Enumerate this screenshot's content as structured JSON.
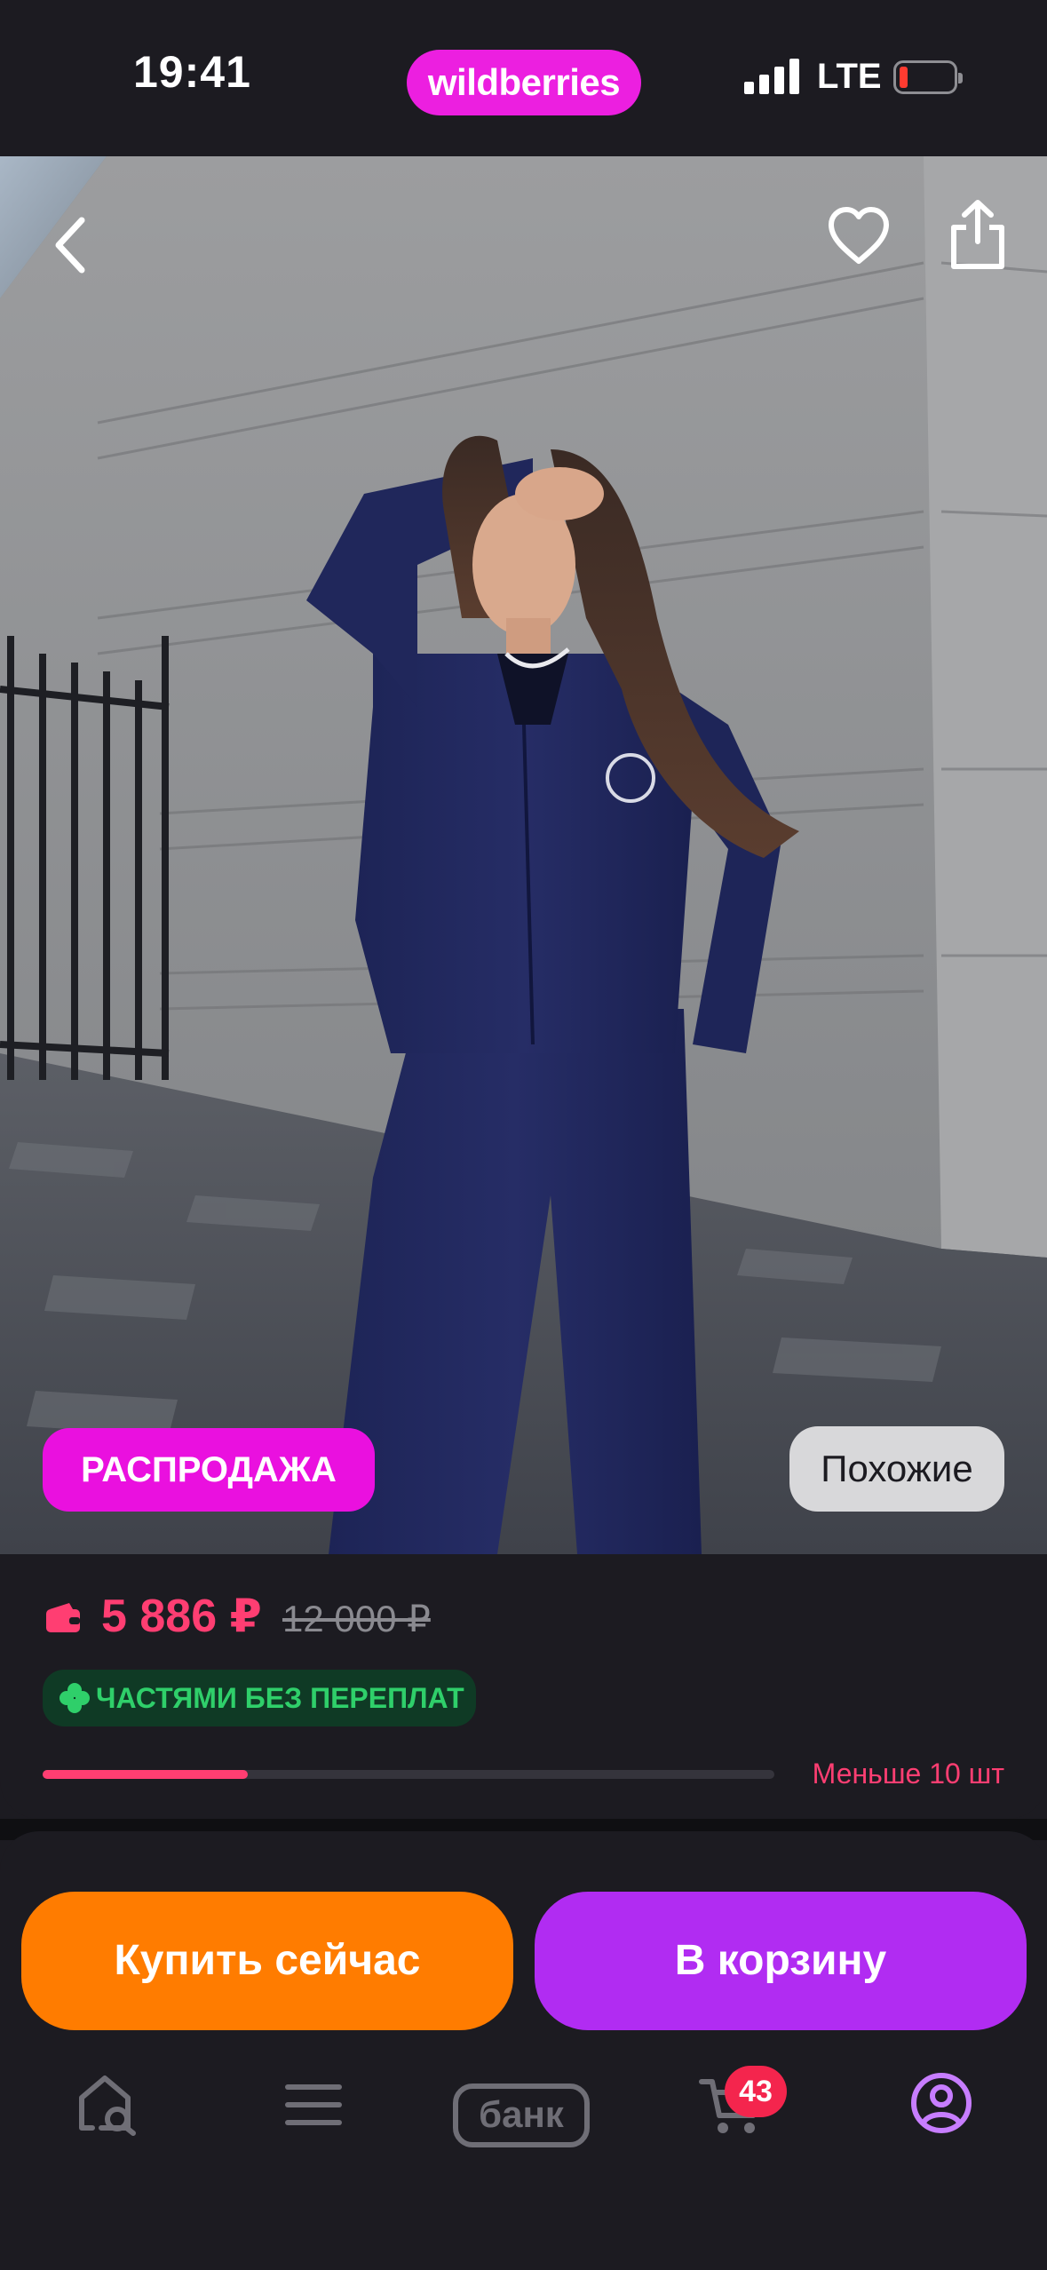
{
  "status_bar": {
    "time": "19:41",
    "network": "LTE",
    "brand": "wildberries"
  },
  "product": {
    "badge": "РАСПРОДАЖА",
    "similar_button": "Похожие",
    "price_current": "5 886 ₽",
    "price_old": "12 000 ₽",
    "installments_label": "ЧАСТЯМИ БЕЗ ПЕРЕПЛАТ",
    "stock_label": "Меньше 10 шт",
    "stock_level": 0.28
  },
  "actions": {
    "buy_now": "Купить сейчас",
    "add_to_cart": "В корзину"
  },
  "tab_bar": {
    "bank_label": "банк",
    "cart_count": "43"
  },
  "icons": [
    "back-icon",
    "heart-icon",
    "share-icon",
    "wallet-icon",
    "clover-icon",
    "search-home-icon",
    "menu-icon",
    "cart-icon",
    "profile-icon"
  ],
  "colors": {
    "brand": "#ec1fe0",
    "price": "#ff3e72",
    "buy_now": "#ff7c00",
    "cart": "#b12cf2",
    "installments_text": "#2fcf6a",
    "active_tab": "#c77dff"
  }
}
